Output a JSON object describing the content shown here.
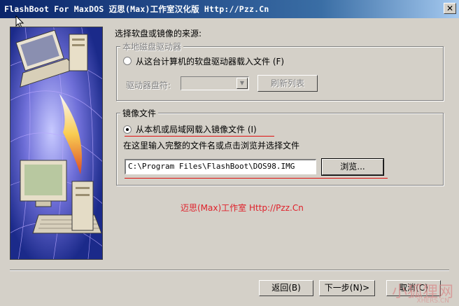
{
  "window": {
    "title": "FlashBoot For MaxDOS 迈思(Max)工作室汉化版 Http://Pzz.Cn",
    "close_symbol": "✕"
  },
  "source": {
    "prompt": "选择软盘或镜像的来源:"
  },
  "floppy_group": {
    "legend": "本地磁盘驱动器",
    "radio_label": "从这台计算机的软盘驱动器载入文件 (F)",
    "radio_checked": false,
    "drive_label": "驱动器盘符:",
    "drive_value": "",
    "refresh_button": "刷新列表"
  },
  "image_group": {
    "legend": "镜像文件",
    "radio_label": "从本机或局域网载入镜像文件 (I)",
    "radio_checked": true,
    "hint": "在这里输入完整的文件名或点击浏览并选择文件",
    "path_value": "C:\\Program Files\\FlashBoot\\DOS98.IMG",
    "browse_button": "浏览..."
  },
  "brand_text": "迈思(Max)工作室 Http://Pzz.Cn",
  "footer": {
    "back_button": "返回(B)",
    "next_button": "下一步(N)>",
    "cancel_button": "取消(C)"
  },
  "watermark": {
    "text": "小狐狸网",
    "sub": "XHERS.CN"
  },
  "colors": {
    "titlebar": "#0a246a",
    "dialog_bg": "#d4d0c8",
    "accent_red": "#e01010"
  }
}
